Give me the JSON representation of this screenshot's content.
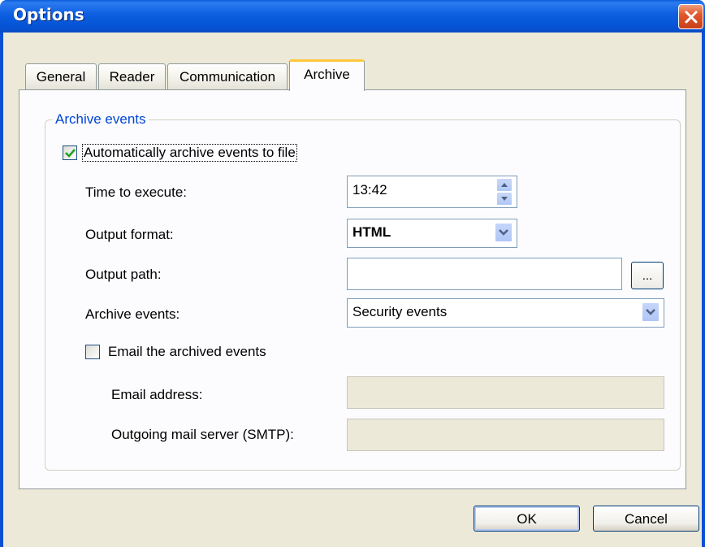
{
  "window": {
    "title": "Options"
  },
  "tabs": [
    {
      "label": "General"
    },
    {
      "label": "Reader"
    },
    {
      "label": "Communication"
    },
    {
      "label": "Archive"
    }
  ],
  "active_tab": "Archive",
  "archive": {
    "group_title": "Archive events",
    "auto_archive": {
      "label": "Automatically archive events to file",
      "checked": true
    },
    "time_to_execute": {
      "label": "Time to execute:",
      "value": "13:42"
    },
    "output_format": {
      "label": "Output format:",
      "value": "HTML"
    },
    "output_path": {
      "label": "Output path:",
      "value": "",
      "browse_label": "..."
    },
    "archive_events": {
      "label": "Archive events:",
      "value": "Security events"
    },
    "email_archived": {
      "label": "Email the archived events",
      "checked": false
    },
    "email_address": {
      "label": "Email address:",
      "value": ""
    },
    "smtp_server": {
      "label": "Outgoing mail server (SMTP):",
      "value": ""
    }
  },
  "buttons": {
    "ok": "OK",
    "cancel": "Cancel"
  },
  "colors": {
    "titlebar": "#0554d6",
    "frame": "#ece9d8",
    "group_title": "#0046d5",
    "check": "#21a121"
  }
}
